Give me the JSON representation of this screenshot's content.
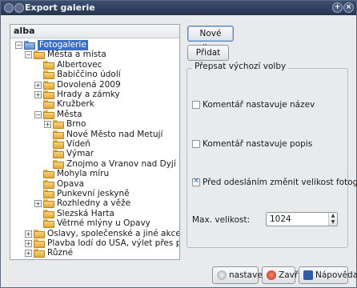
{
  "window": {
    "title": "Export galerie",
    "colors": {
      "titlebar": "#26354f",
      "selection": "#3c6fc4",
      "folder": "#e0a93a"
    }
  },
  "tree": {
    "header": "alba",
    "nodes": [
      {
        "label": "Fotogalerie",
        "expander": "−",
        "selected": true,
        "root": true
      },
      {
        "label": "Města a místa",
        "expander": "−"
      },
      {
        "label": "Albertovec",
        "expander": ""
      },
      {
        "label": "Babiččino údolí",
        "expander": ""
      },
      {
        "label": "Dovolená 2009",
        "expander": "+"
      },
      {
        "label": "Hrady a zámky",
        "expander": "+"
      },
      {
        "label": "Kružberk",
        "expander": ""
      },
      {
        "label": "Města",
        "expander": "−"
      },
      {
        "label": "Brno",
        "expander": "+"
      },
      {
        "label": "Nové Město nad Metují",
        "expander": ""
      },
      {
        "label": "Vídeň",
        "expander": ""
      },
      {
        "label": "Výmar",
        "expander": ""
      },
      {
        "label": "Znojmo a Vranov nad Dyjí",
        "expander": ""
      },
      {
        "label": "Mohyla míru",
        "expander": ""
      },
      {
        "label": "Opava",
        "expander": ""
      },
      {
        "label": "Punkevní jeskyně",
        "expander": ""
      },
      {
        "label": "Rozhledny a věže",
        "expander": "+"
      },
      {
        "label": "Slezská Harta",
        "expander": ""
      },
      {
        "label": "Větrné mlýny u Opavy",
        "expander": ""
      },
      {
        "label": "Oslavy, společenské a jiné akce",
        "expander": "+"
      },
      {
        "label": "Plavba lodí do USA, výlet přes půl světa",
        "expander": "+"
      },
      {
        "label": "Různé",
        "expander": "+"
      }
    ]
  },
  "actions": {
    "new_album": "Nové album",
    "add_photos": "Přidat fotky"
  },
  "defaults": {
    "title": "Přepsat výchozí volby",
    "comment_sets_name": {
      "label": "Komentář nastavuje název",
      "checked": false
    },
    "comment_sets_description": {
      "label": "Komentář nastavuje popis",
      "checked": false
    },
    "resize_before_upload": {
      "label": "Před odesláním změnit velikost fotografií",
      "checked": true
    },
    "max_size_label": "Max. velikost:",
    "max_size_value": "1024"
  },
  "footer": {
    "settings": "nastavení",
    "close": "Zavřít",
    "help": "Nápověda"
  }
}
